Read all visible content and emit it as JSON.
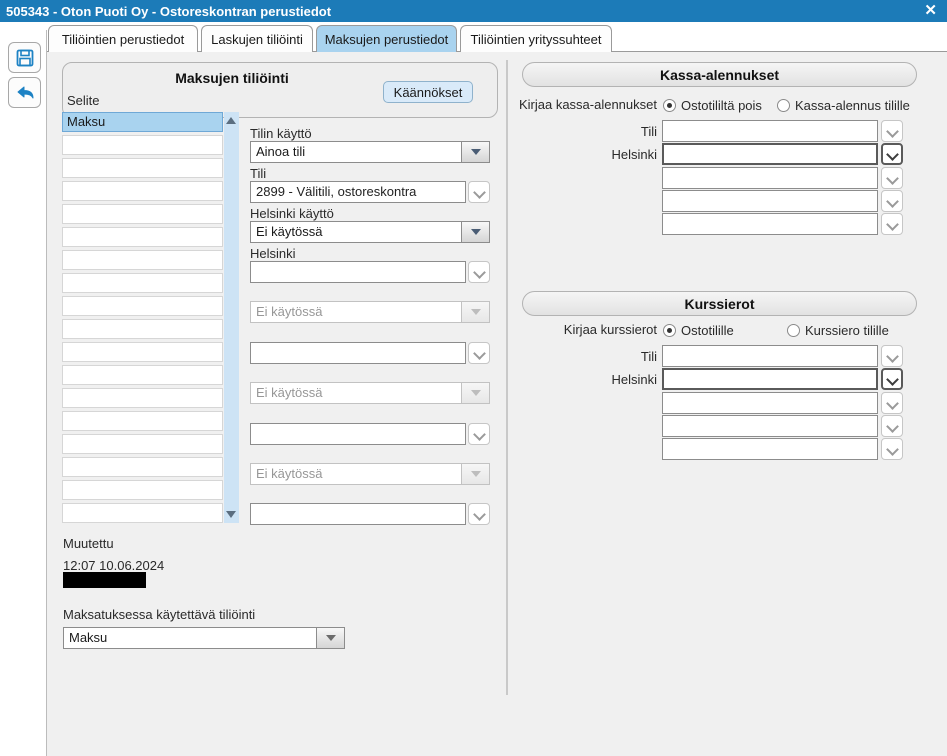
{
  "window": {
    "title": "505343 - Oton Puoti Oy - Ostoreskontran perustiedot",
    "close_glyph": "✕"
  },
  "tabs": [
    {
      "label": "Tiliöintien perustiedot",
      "active": false
    },
    {
      "label": "Laskujen tiliöinti",
      "active": false
    },
    {
      "label": "Maksujen perustiedot",
      "active": true
    },
    {
      "label": "Tiliöintien yrityssuhteet",
      "active": false
    }
  ],
  "toolbar": {
    "save_icon": "floppy-disk",
    "undo_icon": "undo-arrow"
  },
  "left_panel": {
    "title": "Maksujen tiliöinti",
    "translations_button": "Käännökset",
    "selite_label": "Selite",
    "list": {
      "selected_item": "Maksu",
      "empty_rows": 17
    },
    "fields": {
      "tilin_kaytto_label": "Tilin käyttö",
      "tilin_kaytto_value": "Ainoa tili",
      "tili_label": "Tili",
      "tili_value": "2899 - Välitili, ostoreskontra",
      "helsinki_kaytto_label": "Helsinki käyttö",
      "helsinki_kaytto_value": "Ei käytössä",
      "helsinki_label": "Helsinki",
      "disabled_value": "Ei käytössä"
    },
    "muutettu_label": "Muutettu",
    "muutettu_timestamp": "12:07 10.06.2024",
    "maksatus_label": "Maksatuksessa käytettävä tiliöinti",
    "maksatus_value": "Maksu"
  },
  "kassa": {
    "title": "Kassa-alennukset",
    "radio_group_label": "Kirjaa kassa-alennukset",
    "radio_option_1": "Ostotililtä pois",
    "radio_option_2": "Kassa-alennus tilille",
    "selected_option": "Ostotililtä pois",
    "tili_label": "Tili",
    "helsinki_label": "Helsinki"
  },
  "kurssierot": {
    "title": "Kurssierot",
    "radio_group_label": "Kirjaa kurssierot",
    "radio_option_1": "Ostotilille",
    "radio_option_2": "Kurssiero tilille",
    "selected_option": "Ostotilille",
    "tili_label": "Tili",
    "helsinki_label": "Helsinki"
  },
  "colors": {
    "titlebar": "#1c7bb8",
    "active_tab": "#a9d3ef",
    "selection": "#a9d3ef",
    "icon_blue": "#1d82c4",
    "background": "#f0f0f0"
  }
}
